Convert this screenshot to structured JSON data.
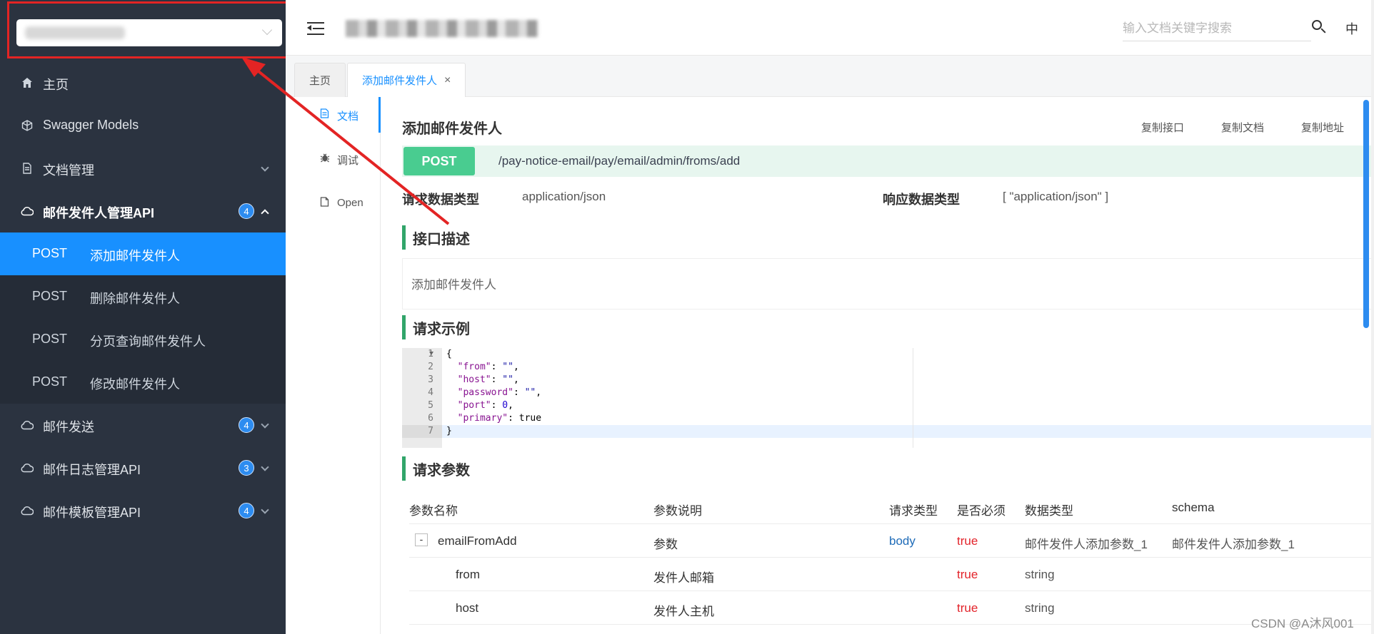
{
  "sidebar": {
    "items": [
      {
        "label": "主页",
        "icon": "home-icon"
      },
      {
        "label": "Swagger Models",
        "icon": "cube-icon"
      },
      {
        "label": "文档管理",
        "icon": "document-icon"
      },
      {
        "label": "邮件发件人管理API",
        "icon": "cloud-icon",
        "badge": "4"
      },
      {
        "label": "邮件发送",
        "icon": "cloud-icon",
        "badge": "4"
      },
      {
        "label": "邮件日志管理API",
        "icon": "cloud-icon",
        "badge": "3"
      },
      {
        "label": "邮件模板管理API",
        "icon": "cloud-icon",
        "badge": "4"
      }
    ],
    "subitems": [
      {
        "method": "POST",
        "label": "添加邮件发件人"
      },
      {
        "method": "POST",
        "label": "删除邮件发件人"
      },
      {
        "method": "POST",
        "label": "分页查询邮件发件人"
      },
      {
        "method": "POST",
        "label": "修改邮件发件人"
      }
    ]
  },
  "header": {
    "search_placeholder": "输入文档关键字搜索",
    "lang": "中"
  },
  "tabs": [
    {
      "label": "主页"
    },
    {
      "label": "添加邮件发件人",
      "close": "×"
    }
  ],
  "subnav": [
    {
      "label": "文档",
      "icon": "document-icon"
    },
    {
      "label": "调试",
      "icon": "bug-icon"
    },
    {
      "label": "Open",
      "icon": "file-icon"
    }
  ],
  "doc": {
    "title": "添加邮件发件人",
    "copy_api": "复制接口",
    "copy_doc": "复制文档",
    "copy_url": "复制地址",
    "method": "POST",
    "path": "/pay-notice-email/pay/email/admin/froms/add",
    "req_type_label": "请求数据类型",
    "req_type_value": "application/json",
    "resp_type_label": "响应数据类型",
    "resp_type_value": "[ \"application/json\" ]",
    "desc_title": "接口描述",
    "desc_text": "添加邮件发件人",
    "example_title": "请求示例",
    "params_title": "请求参数"
  },
  "code": {
    "line_numbers": [
      "1",
      "2",
      "3",
      "4",
      "5",
      "6",
      "7"
    ],
    "l1": "{",
    "l7": "}",
    "keys": [
      "\"from\"",
      "\"host\"",
      "\"password\"",
      "\"port\"",
      "\"primary\""
    ],
    "vals": [
      "\"\"",
      "\"\"",
      "\"\"",
      "0",
      "true"
    ]
  },
  "params": {
    "headers": [
      "参数名称",
      "参数说明",
      "请求类型",
      "是否必须",
      "数据类型",
      "schema"
    ],
    "rows": [
      {
        "name": "emailFromAdd",
        "desc": "参数",
        "in": "body",
        "required": "true",
        "type": "邮件发件人添加参数_1",
        "schema": "邮件发件人添加参数_1",
        "toggle": "-"
      },
      {
        "name": "from",
        "desc": "发件人邮箱",
        "in": "",
        "required": "true",
        "type": "string",
        "schema": ""
      },
      {
        "name": "host",
        "desc": "发件人主机",
        "in": "",
        "required": "true",
        "type": "string",
        "schema": ""
      }
    ]
  },
  "watermark": "CSDN @A沐风001",
  "colors": {
    "accent": "#1890ff",
    "post": "#49cc90",
    "annotation": "#e32424",
    "sidebar": "#2b3340"
  }
}
